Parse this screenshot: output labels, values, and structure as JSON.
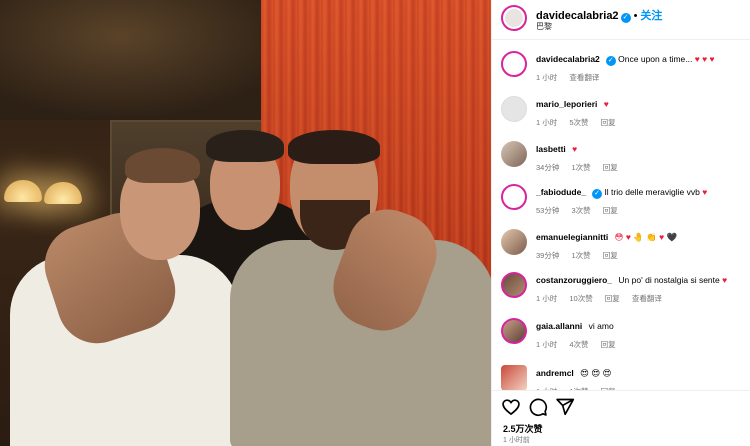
{
  "header": {
    "username": "davidecalabria2",
    "verified_mark": "✓",
    "separator": "•",
    "follow_label": "关注",
    "location": "巴黎"
  },
  "caption": {
    "username": "davidecalabria2",
    "text": "Once upon a time...",
    "hearts": "♥ ♥ ♥",
    "time": "1 小时",
    "translate": "查看翻译"
  },
  "comments": [
    {
      "username": "mario_leporieri",
      "text": "",
      "emoji": "♥",
      "time": "1 小时",
      "likes": "5次赞",
      "reply": "回复"
    },
    {
      "username": "lasbetti",
      "text": "",
      "emoji": "♥",
      "time": "34分钟",
      "likes": "1次赞",
      "reply": "回复"
    },
    {
      "username": "_fabiodude_",
      "verified": "✓",
      "text": "Il trio delle meraviglie vvb",
      "emoji": "♥",
      "time": "53分钟",
      "likes": "3次赞",
      "reply": "回复"
    },
    {
      "username": "emanuelegiannitti",
      "text": "",
      "emoji": "😳 ♥ 🤚 👏 ♥ 🖤",
      "time": "39分钟",
      "likes": "1次赞",
      "reply": "回复"
    },
    {
      "username": "costanzoruggiero_",
      "text": "Un po' di nostalgia si sente",
      "emoji": "♥",
      "time": "1 小时",
      "likes": "10次赞",
      "reply": "回复",
      "translate": "查看翻译"
    },
    {
      "username": "gaia.allanni",
      "text": "vi amo",
      "emoji": "",
      "time": "1 小时",
      "likes": "4次赞",
      "reply": "回复"
    },
    {
      "username": "andremcl",
      "text": "",
      "emoji": "😍 😍 😍",
      "time": "1 小时",
      "likes": "1次赞",
      "reply": "回复"
    }
  ],
  "footer": {
    "likes": "2.5万次赞",
    "time": "1 小时前"
  },
  "icons": [
    "verified-badge-icon",
    "heart-icon",
    "comment-icon",
    "share-icon"
  ],
  "colors": {
    "accent": "#0095f6",
    "heart": "#ed1c3a",
    "meta": "#737373",
    "story_ring": "#d6249f"
  }
}
